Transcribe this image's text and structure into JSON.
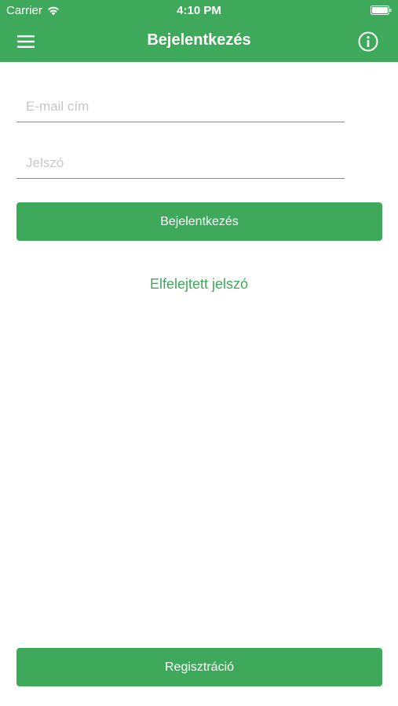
{
  "status_bar": {
    "carrier": "Carrier",
    "time": "4:10 PM"
  },
  "nav": {
    "title": "Bejelentkezés",
    "menu_icon": "hamburger-menu-icon",
    "info_icon": "info-icon"
  },
  "form": {
    "email_placeholder": "E-mail cím",
    "email_value": "",
    "password_placeholder": "Jelszó",
    "password_value": "",
    "login_label": "Bejelentkezés",
    "forgot_label": "Elfelejtett jelszó"
  },
  "footer": {
    "register_label": "Regisztráció"
  },
  "colors": {
    "accent": "#3fa95b",
    "background": "#ffffff",
    "placeholder": "#c7c7cd",
    "underline": "#8a8a8a"
  }
}
